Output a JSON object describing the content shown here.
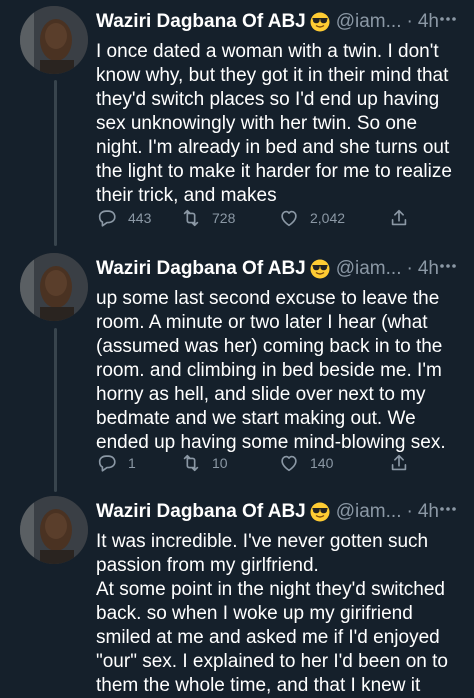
{
  "tweets": [
    {
      "display_name": "Waziri Dagbana Of ABJ",
      "handle": "@iam...",
      "time": "4h",
      "text": "I once dated a woman with a twin. I don't know why, but they got it in their mind that they'd switch places so I'd end up having sex unknowingly with her twin. So one night. I'm already in bed and she turns out the light to make it harder for me to realize their trick, and makes",
      "replies": "443",
      "retweets": "728",
      "likes": "2,042"
    },
    {
      "display_name": "Waziri Dagbana Of ABJ",
      "handle": "@iam...",
      "time": "4h",
      "text": "up some last second excuse to leave the room. A minute or two later I hear (what (assumed was her) coming back in to the room. and climbing in bed beside me. I'm horny as hell, and slide over next to my bedmate and we start making out. We ended up having some mind-blowing sex.",
      "replies": "1",
      "retweets": "10",
      "likes": "140"
    },
    {
      "display_name": "Waziri Dagbana Of ABJ",
      "handle": "@iam...",
      "time": "4h",
      "text_lines": [
        "It was incredible. I've never gotten such passion from my girlfriend.",
        "At some point in the night they'd switched back. so when I woke up my girifriend smiled at me and asked me if I'd enjoyed \"our\" sex. I explained to her I'd been on to them the whole time, and that I knew it"
      ]
    }
  ],
  "icons": {
    "emoji": "sunglasses-emoji-icon",
    "reply": "reply-icon",
    "retweet": "retweet-icon",
    "like": "heart-icon",
    "share": "share-icon",
    "more": "more-icon"
  },
  "colors": {
    "background": "#15202b",
    "secondary_text": "#8b98a5",
    "thread_line": "#38444d"
  }
}
